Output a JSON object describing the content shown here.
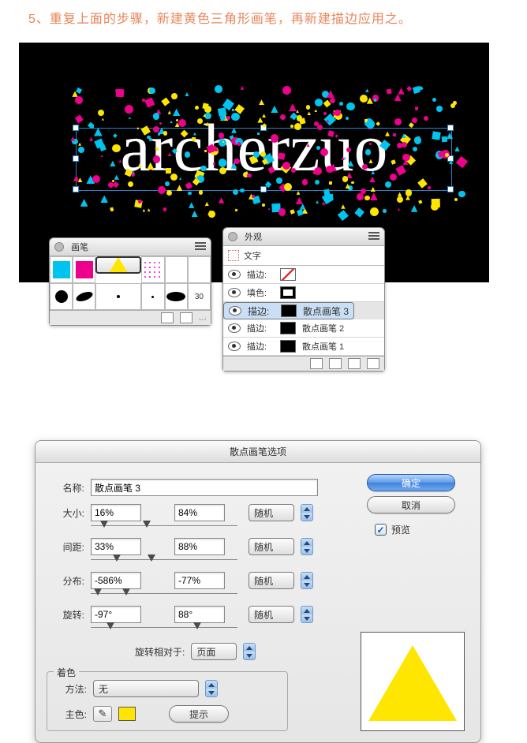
{
  "instruction": "5、重复上面的步骤，新建黄色三角形画笔，再新建描边应用之。",
  "canvas": {
    "text": "archerzuo"
  },
  "brush_panel": {
    "title": "画笔",
    "cells": [
      "cyan",
      "magenta",
      "yellow-tri",
      "multi",
      "",
      "",
      "black-circle",
      "black-oval",
      "dot",
      "small",
      "oval-lg",
      "30"
    ],
    "size_label": "30"
  },
  "appear_panel": {
    "title": "外观",
    "subtitle": "文字",
    "rows": [
      {
        "label": "描边:",
        "swatch": "none",
        "text": ""
      },
      {
        "label": "填色:",
        "swatch": "hollow",
        "text": ""
      },
      {
        "label": "描边:",
        "swatch": "black",
        "text": "散点画笔 3",
        "selected": true
      },
      {
        "label": "描边:",
        "swatch": "black",
        "text": "散点画笔 2"
      },
      {
        "label": "描边:",
        "swatch": "black",
        "text": "散点画笔 1"
      }
    ]
  },
  "dialog": {
    "title": "散点画笔选项",
    "name_label": "名称:",
    "name_value": "散点画笔 3",
    "params": [
      {
        "label": "大小:",
        "a": "16%",
        "b": "84%",
        "mode": "随机",
        "ta": 12,
        "tb": 66
      },
      {
        "label": "间距:",
        "a": "33%",
        "b": "88%",
        "mode": "随机",
        "ta": 28,
        "tb": 72
      },
      {
        "label": "分布:",
        "a": "-586%",
        "b": "-77%",
        "mode": "随机",
        "ta": 4,
        "tb": 40
      },
      {
        "label": "旋转:",
        "a": "-97°",
        "b": "88°",
        "mode": "随机",
        "ta": 20,
        "tb": 130
      }
    ],
    "rotate_rel_label": "旋转相对于:",
    "rotate_rel_value": "页面",
    "tint_legend": "着色",
    "tint_method_label": "方法:",
    "tint_method_value": "无",
    "tint_key_label": "主色:",
    "tint_hint": "提示",
    "ok": "确定",
    "cancel": "取消",
    "preview": "预览"
  }
}
